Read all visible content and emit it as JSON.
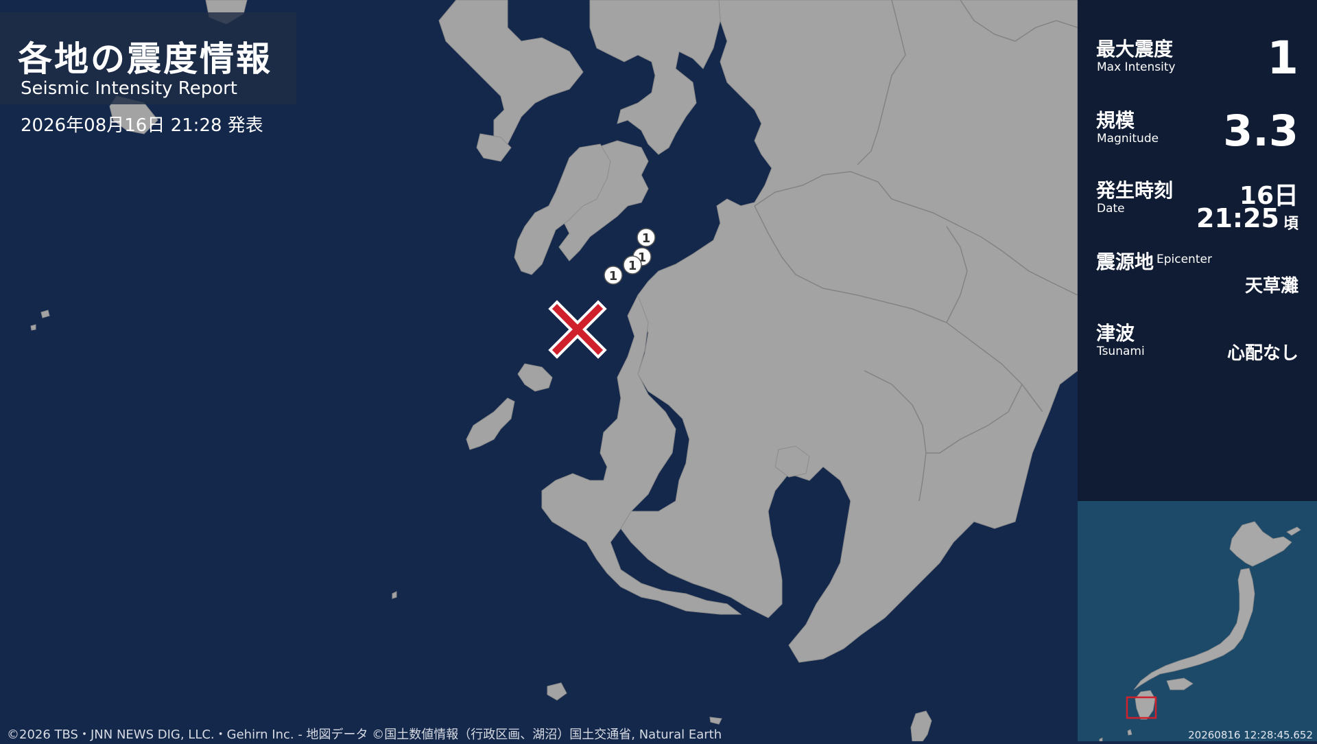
{
  "header": {
    "title_jp": "各地の震度情報",
    "title_en": "Seismic Intensity Report",
    "issued": "2026年08月16日 21:28 発表"
  },
  "summary": {
    "max_intensity_jp": "最大震度",
    "max_intensity_en": "Max Intensity",
    "max_intensity_value": "1",
    "magnitude_jp": "規模",
    "magnitude_en": "Magnitude",
    "magnitude_value": "3.3",
    "date_jp": "発生時刻",
    "date_en": "Date",
    "date_day": "16日",
    "date_time": "21:25",
    "date_suffix": "頃",
    "epicenter_jp": "震源地",
    "epicenter_en": "Epicenter",
    "epicenter_value": "天草灘",
    "tsunami_jp": "津波",
    "tsunami_en": "Tsunami",
    "tsunami_value": "心配なし"
  },
  "intensity_markers": [
    {
      "label": "1"
    },
    {
      "label": "1"
    },
    {
      "label": "1"
    },
    {
      "label": "1"
    }
  ],
  "footer": {
    "copyright": "©2026 TBS・JNN NEWS DIG, LLC.・Gehirn Inc. - 地図データ ©国土数値情報（行政区画、湖沼）国土交通省, Natural Earth",
    "timestamp": "20260816 12:28:45.652"
  },
  "colors": {
    "sea": "#14284b",
    "land": "#a3a3a3",
    "panel": "#101c33",
    "epicenter": "#d0202c",
    "inset_sea": "#1e4a6a"
  }
}
